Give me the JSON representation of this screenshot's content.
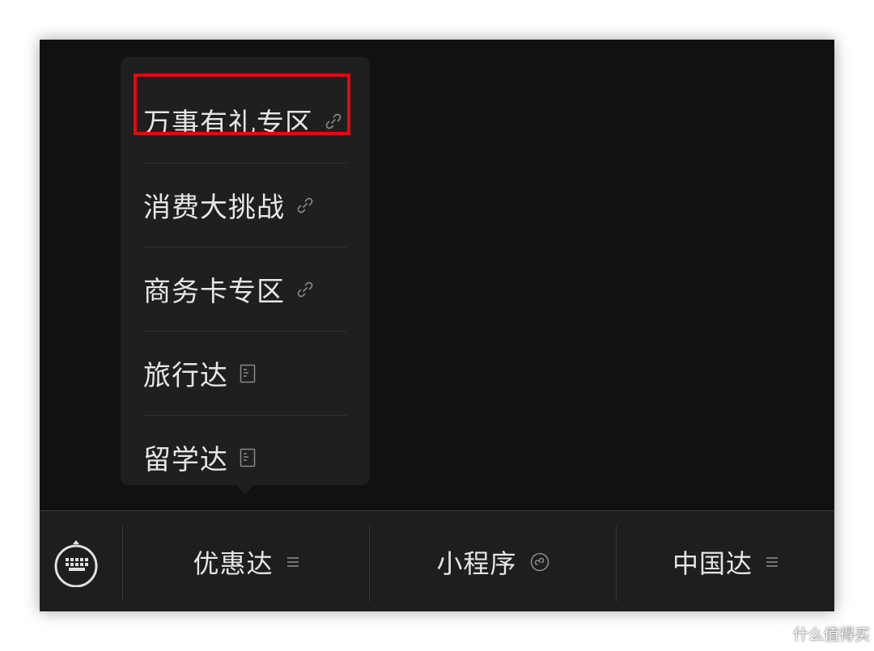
{
  "menu": {
    "items": [
      {
        "label": "万事有礼专区",
        "icon": "link-icon",
        "highlighted": true
      },
      {
        "label": "消费大挑战",
        "icon": "link-icon",
        "highlighted": false
      },
      {
        "label": "商务卡专区",
        "icon": "link-icon",
        "highlighted": false
      },
      {
        "label": "旅行达",
        "icon": "article-icon",
        "highlighted": false
      },
      {
        "label": "留学达",
        "icon": "article-icon",
        "highlighted": false
      }
    ]
  },
  "bottom_bar": {
    "keyboard_icon": "keyboard-icon",
    "tabs": [
      {
        "label": "优惠达",
        "icon": "menu-lines-icon"
      },
      {
        "label": "小程序",
        "icon": "mini-program-icon"
      },
      {
        "label": "中国达",
        "icon": "menu-lines-icon"
      }
    ]
  },
  "colors": {
    "background": "#111111",
    "popup": "#1f1f1f",
    "highlight_border": "#e3090d",
    "text": "#e6e6e6",
    "icon": "#8a8a8a"
  },
  "watermark": {
    "text": "什么值得买",
    "icon": "smzdm-logo-icon"
  }
}
